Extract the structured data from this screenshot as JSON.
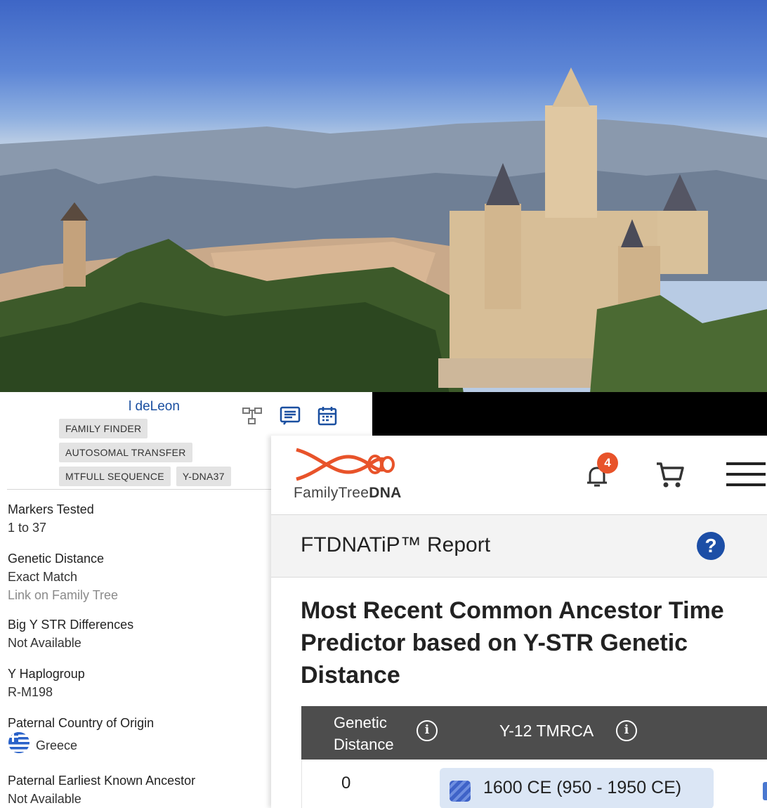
{
  "colors": {
    "brand_orange": "#e8532a",
    "link_blue": "#1a4fa0",
    "help_blue": "#1c4ea6",
    "table_header": "#4d4d4d",
    "pill_bg": "#dbe6f5"
  },
  "match": {
    "name": "l deLeon",
    "tools": [
      "family-tree-icon",
      "notes-icon",
      "calendar-icon"
    ],
    "tags": [
      [
        "FAMILY FINDER"
      ],
      [
        "AUTOSOMAL TRANSFER"
      ],
      [
        "MTFULL SEQUENCE",
        "Y-DNA37"
      ]
    ],
    "fields": {
      "markers_label": "Markers Tested",
      "markers_value": "1 to 37",
      "gd_label": "Genetic Distance",
      "gd_value": "Exact Match",
      "gd_link": "Link on Family Tree",
      "bigy_label": "Big Y STR Differences",
      "bigy_value": "Not Available",
      "haplo_label": "Y Haplogroup",
      "haplo_value": "R-M198",
      "country_label": "Paternal Country of Origin",
      "country_value": "Greece",
      "ancestor_label": "Paternal Earliest Known Ancestor",
      "ancestor_value": "Not Available"
    }
  },
  "app": {
    "logo_text_light": "FamilyTree",
    "logo_text_bold": "DNA",
    "notification_count": "4",
    "report_title": "FTDNATiP™ Report",
    "help_label": "?",
    "headline": "Most Recent Common Ancestor Time Predictor based on Y-STR Genetic Distance",
    "table": {
      "col_gd_line1": "Genetic",
      "col_gd_line2": "Distance",
      "col_tmrca": "Y-12 TMRCA",
      "info_glyph": "i",
      "rows": [
        {
          "gd": "0",
          "tmrca": "1600 CE (950 - 1950 CE)"
        }
      ]
    }
  }
}
